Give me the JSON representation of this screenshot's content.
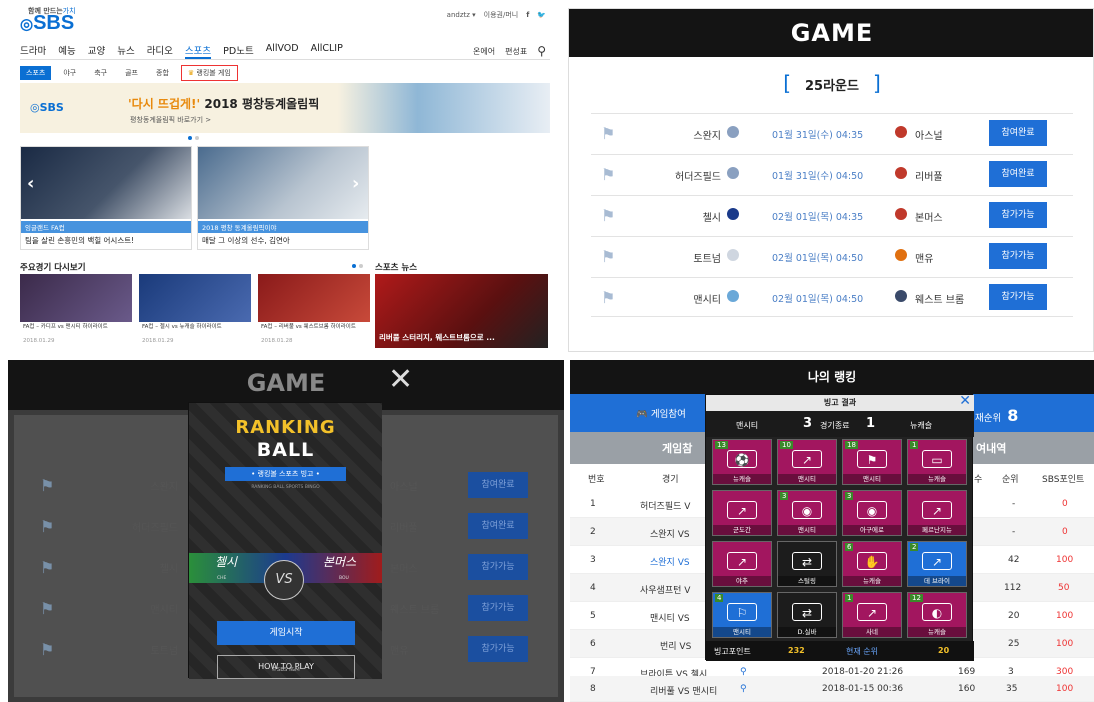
{
  "q1": {
    "slogan": "함께 만드는",
    "slogan_hl": "가치",
    "logo": "SBS",
    "user": "andztz ▾",
    "links": "이용권/머니",
    "nav": [
      "드라마",
      "예능",
      "교양",
      "뉴스",
      "라디오",
      "스포츠",
      "PD노트",
      "AllVOD",
      "AllCLIP"
    ],
    "nav_right": [
      "온에어",
      "편성표"
    ],
    "subnav": [
      "스포츠",
      "야구",
      "축구",
      "골프",
      "종합",
      "랭킹볼 게임"
    ],
    "banner_logo": "SBS",
    "banner_title_quote": "'다시 뜨겁게!'",
    "banner_title_rest": " 2018 평창동계올림픽",
    "banner_sub": "평창동계올림픽 바로가기 >",
    "card1_tag": "잉글랜드 FA컵",
    "card1_cap": "팀을 살린 손흥민의 백힐 어시스트!",
    "card2_tag": "2018 평창 동계올림픽이야",
    "card2_cap": "매달 그 이상의 선수, 김연아",
    "sec_replay": "주요경기 다시보기",
    "sec_news": "스포츠 뉴스",
    "thumbs": [
      {
        "title": "FA컵 – 카디프 vs 맨시티 하이라이트",
        "date": "2018.01.29"
      },
      {
        "title": "FA컵 – 첼시 vs 뉴캐슬 하이라이트",
        "date": "2018.01.29"
      },
      {
        "title": "FA컵 – 리버풀 vs 웨스트브롬 하이라이트",
        "date": "2018.01.28"
      }
    ],
    "news_cap": "리버풀 스터리지, 웨스트브롬으로 ..."
  },
  "q2": {
    "title": "GAME",
    "round": "25라운드",
    "games": [
      {
        "home": "스완지",
        "time": "01월 31일(수) 04:35",
        "away": "아스널",
        "btn": "참여완료"
      },
      {
        "home": "허더즈필드",
        "time": "01월 31일(수) 04:50",
        "away": "리버풀",
        "btn": "참여완료"
      },
      {
        "home": "첼시",
        "time": "02월 01일(목) 04:35",
        "away": "본머스",
        "btn": "참가가능"
      },
      {
        "home": "토트넘",
        "time": "02월 01일(목) 04:50",
        "away": "맨유",
        "btn": "참가가능"
      },
      {
        "home": "맨시티",
        "time": "02월 01일(목) 04:50",
        "away": "웨스트 브롬",
        "btn": "참가가능"
      }
    ]
  },
  "q3": {
    "title": "GAME",
    "rows": [
      {
        "home": "스완지",
        "away": "아스널",
        "btn": "참여완료"
      },
      {
        "home": "허더즈필드",
        "away": "리버풀",
        "btn": "참여완료"
      },
      {
        "home": "첼시",
        "away": "본머스",
        "btn": "참가가능"
      },
      {
        "home": "맨시티",
        "away": "웨스트 브롬",
        "btn": "참가가능"
      },
      {
        "home": "토트넘",
        "away": "맨유",
        "btn": "참가가능"
      }
    ],
    "modal": {
      "title1": "RANKING",
      "title2": "BALL",
      "sub": "• 랭킹볼 스포츠 빙고 •",
      "sub2": "RANKING BALL SPORTS BINGO",
      "team_l": "첼시",
      "team_r": "본머스",
      "short_l": "CHE",
      "short_r": "BOU",
      "vs": "VS",
      "start": "게임시작",
      "how": "HOW TO PLAY",
      "copy": "©SBS I&M"
    }
  },
  "q4": {
    "title": "나의 랭킹",
    "join": "게임참여",
    "rank_label": "재순위",
    "rank": "8",
    "gray_l": "게임참",
    "gray_r": "여내역",
    "cols": {
      "no": "번호",
      "game": "경기",
      "cnt": "수",
      "rank": "순위",
      "pts": "SBS포인트"
    },
    "rows": [
      {
        "no": "1",
        "game": "허더즈필드 V",
        "cnt": "",
        "rank": "-",
        "pts": "0"
      },
      {
        "no": "2",
        "game": "스완지 VS",
        "cnt": "",
        "rank": "-",
        "pts": "0"
      },
      {
        "no": "3",
        "game": "스완지 VS",
        "cnt": "42",
        "rank": "",
        "pts": "100"
      },
      {
        "no": "4",
        "game": "사우샘프턴 V",
        "cnt": "112",
        "rank": "",
        "pts": "50"
      },
      {
        "no": "5",
        "game": "맨시티 VS",
        "cnt": "20",
        "rank": "",
        "pts": "100"
      },
      {
        "no": "6",
        "game": "번리 VS",
        "cnt": "25",
        "rank": "",
        "pts": "100"
      },
      {
        "no": "7",
        "game": "브라이튼 VS 첼시",
        "date": "2018-01-20 21:26",
        "cnt": "169",
        "rank": "3",
        "pts": "300"
      },
      {
        "no": "8",
        "game": "리버풀 VS 맨시티",
        "date": "2018-01-15 00:36",
        "cnt": "160",
        "rank": "35",
        "pts": "100"
      }
    ],
    "bingo": {
      "head": "빙고 결과",
      "home": "맨시티",
      "home_score": "3",
      "status": "경기종료",
      "away_score": "1",
      "away": "뉴캐슬",
      "cells": [
        {
          "num": "13",
          "name": "뉴캐슬",
          "style": "mag"
        },
        {
          "num": "10",
          "name": "맨시티",
          "style": "mag"
        },
        {
          "num": "18",
          "name": "맨시티",
          "style": "mag"
        },
        {
          "num": "1",
          "name": "뉴캐슬",
          "style": "mag"
        },
        {
          "num": "",
          "name": "군도간",
          "style": "mag"
        },
        {
          "num": "3",
          "name": "맨시티",
          "style": "mag"
        },
        {
          "num": "3",
          "name": "아구에로",
          "style": "mag"
        },
        {
          "num": "",
          "name": "페르난지뉴",
          "style": "mag"
        },
        {
          "num": "",
          "name": "야추",
          "style": "mag"
        },
        {
          "num": "",
          "name": "스털링",
          "style": "dark"
        },
        {
          "num": "6",
          "name": "뉴캐슬",
          "style": "mag"
        },
        {
          "num": "2",
          "name": "데 브라이",
          "style": "blue"
        },
        {
          "num": "4",
          "name": "맨시티",
          "style": "blue"
        },
        {
          "num": "",
          "name": "D.실바",
          "style": "dark"
        },
        {
          "num": "1",
          "name": "사네",
          "style": "mag"
        },
        {
          "num": "12",
          "name": "뉴캐슬",
          "style": "mag"
        }
      ],
      "points_label": "빙고포인트",
      "points": "232",
      "rank_label": "현재 순위",
      "rank": "20"
    }
  }
}
